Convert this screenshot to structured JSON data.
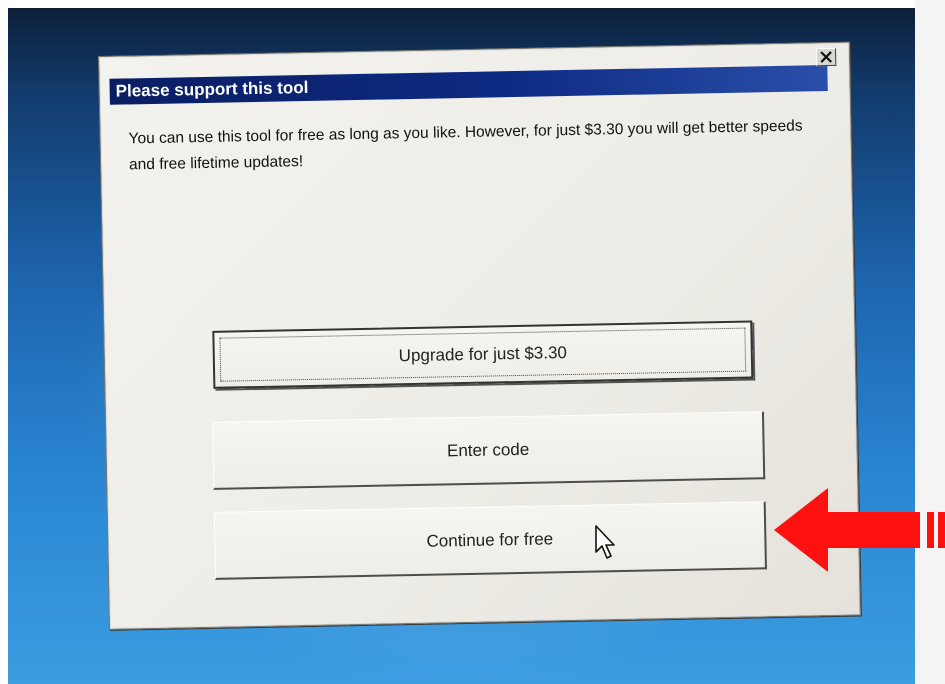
{
  "dialog": {
    "title": "Please support this tool",
    "message": "You can use this tool for free as long as you like. However, for just $3.30 you will get better speeds and free lifetime updates!",
    "buttons": {
      "upgrade_label": "Upgrade for just $3.30",
      "enter_code_label": "Enter code",
      "continue_label": "Continue for free"
    },
    "close_icon": "close-x-icon"
  },
  "annotation": {
    "arrow_color": "#ff0000",
    "arrow_icon": "left-arrow-icon"
  },
  "colors": {
    "titlebar": "#0d2a83",
    "dialog_bg": "#efede7",
    "desktop": "#2a86d2"
  }
}
